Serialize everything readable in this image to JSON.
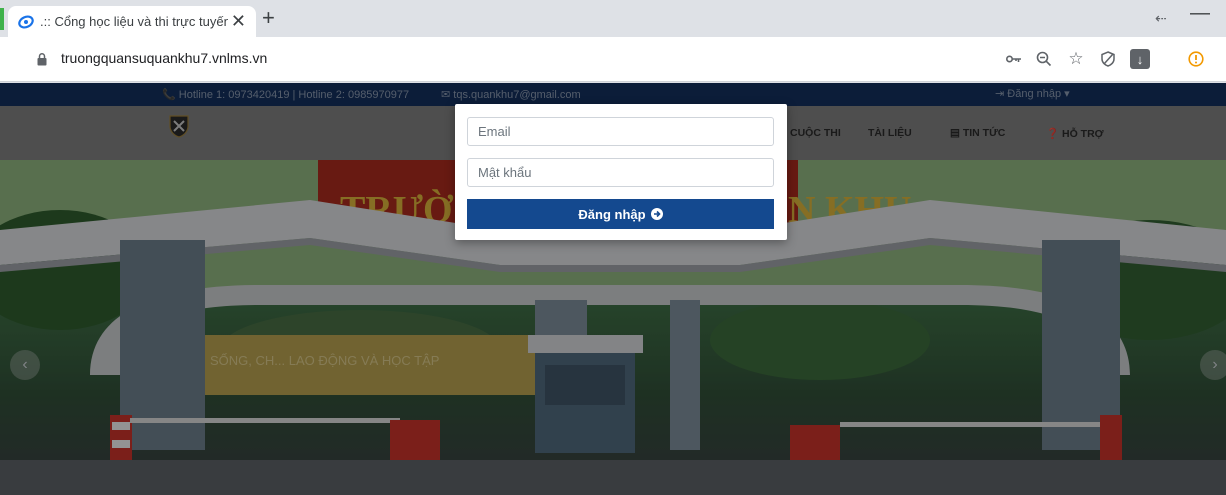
{
  "browser": {
    "tab_title": ".:: Cổng học liệu và thi trực tuyến",
    "url": "truongquansuquankhu7.vnlms.vn",
    "new_tab_symbol": "+",
    "close_symbol": "✕"
  },
  "site": {
    "hotline": "📞 Hotline 1: 0973420419 | Hotline 2: 0985970977",
    "email": "✉ tqs.quankhu7@gmail.com",
    "login_link": "⇥ Đăng nhập ▾",
    "nav": [
      "CUỘC THI",
      "TÀI LIỆU",
      "TIN TỨC",
      "HỖ TRỢ"
    ]
  },
  "hero": {
    "sign_left": "TRƯỜ",
    "sign_right": "N KHU",
    "wall_text": "SỐNG, CH... LAO ĐỘNG VÀ HỌC TẬP"
  },
  "login_form": {
    "email_placeholder": "Email",
    "password_placeholder": "Mật khẩu",
    "submit_label": "Đăng nhập"
  },
  "colors": {
    "brand_blue": "#14498f",
    "topbar": "#14305d"
  }
}
